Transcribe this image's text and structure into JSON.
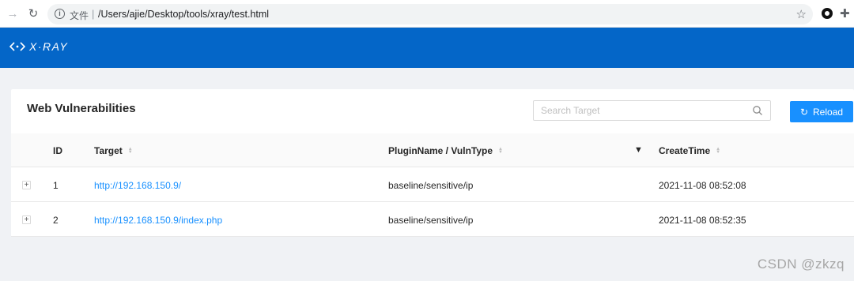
{
  "browser": {
    "file_label": "文件",
    "url": "/Users/ajie/Desktop/tools/xray/test.html"
  },
  "app": {
    "logo_text": "X·RAY",
    "brand_color": "#0466c8"
  },
  "panel": {
    "title": "Web Vulnerabilities",
    "search_placeholder": "Search Target",
    "reload_label": "Reload"
  },
  "table": {
    "headers": {
      "id": "ID",
      "target": "Target",
      "plugin": "PluginName / VulnType",
      "create_time": "CreateTime"
    },
    "rows": [
      {
        "id": "1",
        "target": "http://192.168.150.9/",
        "plugin": "baseline/sensitive/ip",
        "create_time": "2021-11-08 08:52:08"
      },
      {
        "id": "2",
        "target": "http://192.168.150.9/index.php",
        "plugin": "baseline/sensitive/ip",
        "create_time": "2021-11-08 08:52:35"
      }
    ]
  },
  "watermark": "CSDN @zkzq"
}
